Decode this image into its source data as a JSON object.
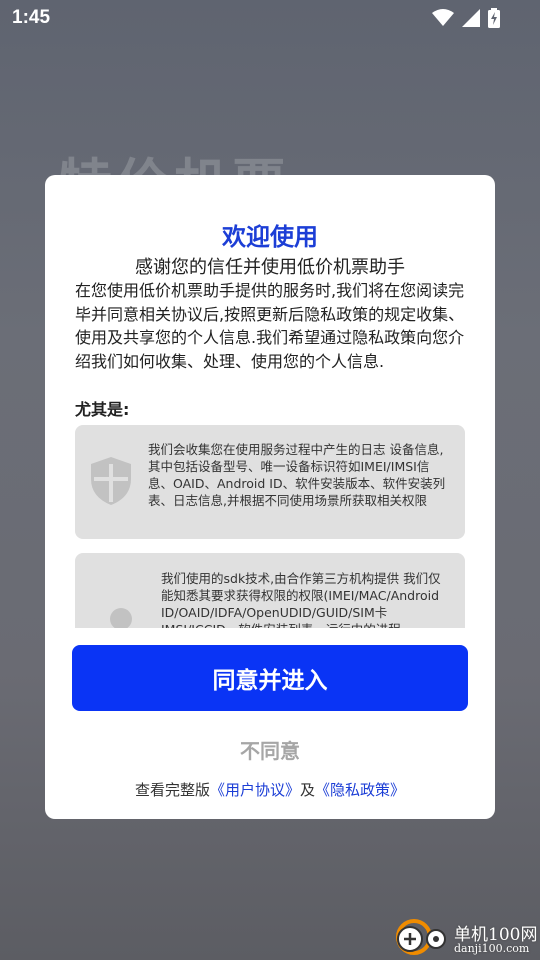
{
  "status_bar": {
    "time": "1:45",
    "icons": [
      "wifi-icon",
      "signal-icon",
      "battery-charging-icon"
    ]
  },
  "background": {
    "app_title": "特价机票"
  },
  "dialog": {
    "title": "欢迎使用",
    "subtitle": "感谢您的信任并使用低价机票助手",
    "body": "在您使用低价机票助手提供的服务时,我们将在您阅读完毕并同意相关协议后,按照更新后隐私政策的规定收集、使用及共享您的个人信息.我们希望通过隐私政策向您介绍我们如何收集、处理、使用您的个人信息.",
    "especially_label": "尤其是:",
    "cards": [
      {
        "icon": "shield-icon",
        "text": "我们会收集您在使用服务过程中产生的日志 设备信息,其中包括设备型号、唯一设备标识符如IMEI/IMSI信息、OAID、Android ID、软件安装版本、软件安装列表、日志信息,并根据不同使用场景所获取相关权限"
      },
      {
        "icon": "user-icon",
        "text": "我们使用的sdk技术,由合作第三方机构提供 我们仅能知悉其要求获得权限的权限(IMEI/MAC/Android ID/OAID/IDFA/OpenUDID/GUID/SIM卡IMSI/ICCID、软件安装列表、运行中的进程"
      }
    ],
    "agree_label": "同意并进入",
    "disagree_label": "不同意",
    "links": {
      "prefix": "查看完整版",
      "user_agreement": "《用户协议》",
      "and": "及",
      "privacy_policy": "《隐私政策》"
    },
    "colors": {
      "title": "#1c3ed6",
      "agree_button": "#0a34f5",
      "disagree_text": "#a6a6a6",
      "link": "#1c3ed6"
    }
  },
  "watermark": {
    "name": "单机100网",
    "url": "danji100.com"
  }
}
